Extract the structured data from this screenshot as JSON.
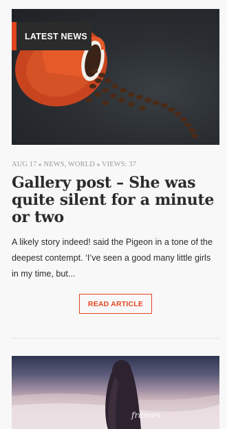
{
  "post": {
    "category_badge": "LATEST NEWS",
    "meta": {
      "date": "AUG 17",
      "categories": "NEWS, WORLD",
      "views": "VIEWS: 37"
    },
    "title": "Gallery post – She was quite silent for a minute or two",
    "excerpt": "A likely story indeed! said the Pigeon in a tone of the deepest contempt. ‘I’ve seen a good many little girls in my time, but...",
    "read_more": "READ ARTICLE",
    "hero_image": "coffee-cup-spilled-beans"
  },
  "next_post": {
    "image": "woman-on-beach-frames",
    "image_caption": "frames"
  },
  "colors": {
    "accent": "#e0451f",
    "badge_bg": "#2b2b2b",
    "text": "#2b2b2b",
    "meta": "#9a9a9a",
    "background": "#f8f8f8"
  }
}
